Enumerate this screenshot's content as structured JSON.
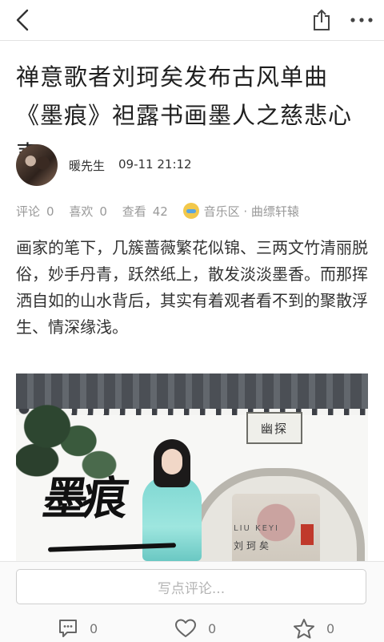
{
  "header": {
    "back_icon": "chevron-left-icon",
    "share_icon": "share-icon",
    "more_icon": "more-dots-icon"
  },
  "article": {
    "title": "禅意歌者刘珂矣发布古风单曲《墨痕》袒露书画墨人之慈悲心声",
    "author": {
      "name": "暖先生",
      "time": "09-11 21:12"
    },
    "meta": {
      "comments_label": "评论",
      "comments_count": "0",
      "likes_label": "喜欢",
      "likes_count": "0",
      "views_label": "查看",
      "views_count": "42",
      "section": "音乐区 · 曲缥轩辕"
    },
    "body": "画家的笔下，几簇蔷薇繁花似锦、三两文竹清丽脱俗，妙手丹青，跃然纸上，散发淡淡墨香。而那挥洒自如的山水背后，其实有着观者看不到的聚散浮生、情深缘浅。",
    "image": {
      "calligraphy": "墨痕",
      "plaque": "幽探",
      "artist_en": "LIU KEYI",
      "artist_cn": "刘珂矣"
    }
  },
  "footer": {
    "comment_placeholder": "写点评论...",
    "comments_count": "0",
    "likes_count": "0",
    "favorites_count": "0"
  },
  "colors": {
    "text": "#1f1f1f",
    "muted": "#999999",
    "border": "#e2e2e2"
  }
}
